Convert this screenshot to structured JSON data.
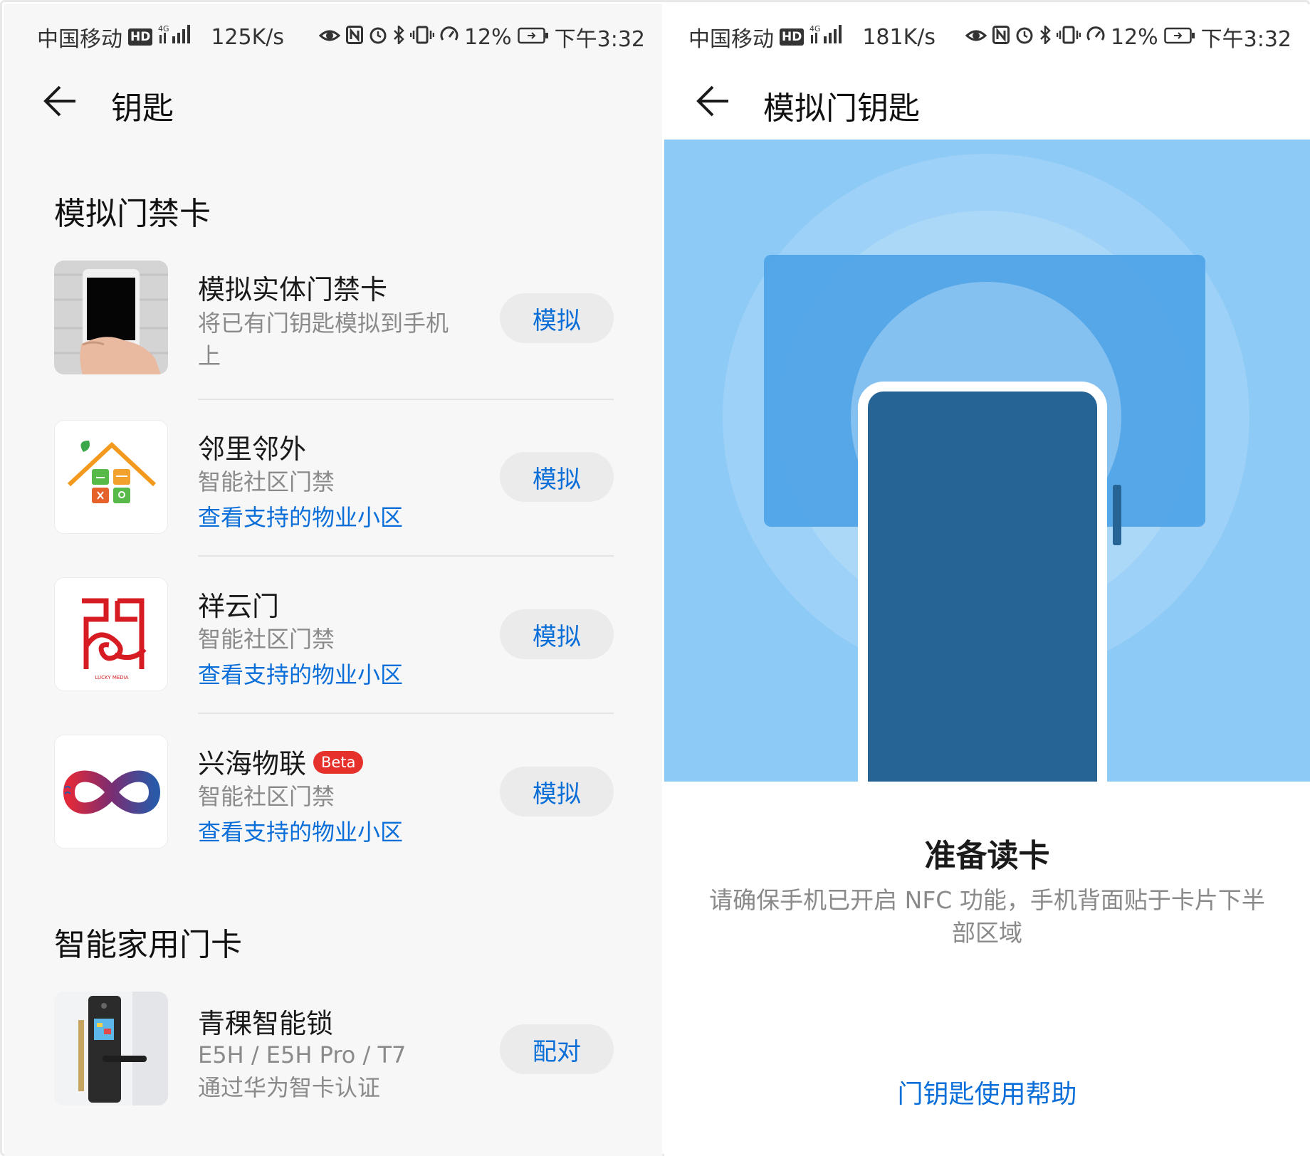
{
  "left_screen": {
    "status": {
      "carrier": "中国移动",
      "hd": "HD",
      "network": "4G",
      "speed": "125K/s",
      "battery": "12%",
      "time": "下午3:32"
    },
    "title": "钥匙",
    "sections": [
      {
        "title": "模拟门禁卡",
        "items": [
          {
            "name": "模拟实体门禁卡",
            "desc": "将已有门钥匙模拟到手机上",
            "action": "模拟",
            "icon": "phone-in-hand-icon"
          },
          {
            "name": "邻里邻外",
            "desc": "智能社区门禁",
            "link": "查看支持的物业小区",
            "action": "模拟",
            "icon": "house-services-logo"
          },
          {
            "name": "祥云门",
            "desc": "智能社区门禁",
            "link": "查看支持的物业小区",
            "action": "模拟",
            "icon": "xiangyun-door-logo",
            "logo_text": "LUCKY MEDIA"
          },
          {
            "name": "兴海物联",
            "badge": "Beta",
            "desc": "智能社区门禁",
            "link": "查看支持的物业小区",
            "action": "模拟",
            "icon": "infinity-logo"
          }
        ]
      },
      {
        "title": "智能家用门卡",
        "items": [
          {
            "name": "青稞智能锁",
            "desc": "E5H / E5H Pro / T7",
            "desc2": "通过华为智卡认证",
            "action": "配对",
            "icon": "smart-lock-icon"
          }
        ]
      }
    ]
  },
  "right_screen": {
    "status": {
      "carrier": "中国移动",
      "hd": "HD",
      "network": "4G",
      "speed": "181K/s",
      "battery": "12%",
      "time": "下午3:32"
    },
    "title": "模拟门钥匙",
    "ready_title": "准备读卡",
    "ready_desc": "请确保手机已开启 NFC 功能，手机背面贴于卡片下半部区域",
    "help_link": "门钥匙使用帮助"
  },
  "colors": {
    "accent": "#0a6ed9",
    "illustration_bg": "#8ecaf6",
    "card": "#4ea3e6",
    "phone": "#266496",
    "beta": "#e5302c"
  }
}
